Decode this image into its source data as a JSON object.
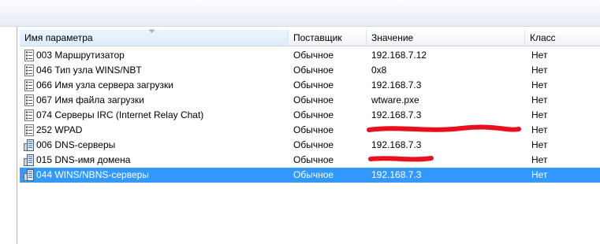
{
  "columns": [
    {
      "label": "Имя параметра"
    },
    {
      "label": "Поставщик"
    },
    {
      "label": "Значение"
    },
    {
      "label": "Класс"
    }
  ],
  "rows": [
    {
      "name": "003 Маршрутизатор",
      "vendor": "Обычное",
      "value": "192.168.7.12",
      "class": "Нет",
      "icon": "option-list-icon"
    },
    {
      "name": "046 Тип узла WINS/NBT",
      "vendor": "Обычное",
      "value": "0x8",
      "class": "Нет",
      "icon": "option-list-icon"
    },
    {
      "name": "066 Имя узла сервера загрузки",
      "vendor": "Обычное",
      "value": "192.168.7.3",
      "class": "Нет",
      "icon": "option-list-icon"
    },
    {
      "name": "067 Имя файла загрузки",
      "vendor": "Обычное",
      "value": "wtware.pxe",
      "class": "Нет",
      "icon": "option-list-icon"
    },
    {
      "name": "074 Серверы IRC (Internet Relay Chat)",
      "vendor": "Обычное",
      "value": "192.168.7.3",
      "class": "Нет",
      "icon": "option-list-icon"
    },
    {
      "name": "252 WPAD",
      "vendor": "Обычное",
      "value": "",
      "class": "Нет",
      "icon": "option-list-icon"
    },
    {
      "name": "006 DNS-серверы",
      "vendor": "Обычное",
      "value": "192.168.7.3",
      "class": "Нет",
      "icon": "server-icon"
    },
    {
      "name": "015 DNS-имя домена",
      "vendor": "Обычное",
      "value": "",
      "class": "Нет",
      "icon": "server-icon"
    },
    {
      "name": "044 WINS/NBNS-серверы",
      "vendor": "Обычное",
      "value": "192.168.7.3",
      "class": "Нет",
      "icon": "server-icon"
    }
  ],
  "selected_row": "044 WINS/NBNS-серверы",
  "colors": {
    "selection": "#3399ff",
    "redaction": "#e8101e"
  }
}
